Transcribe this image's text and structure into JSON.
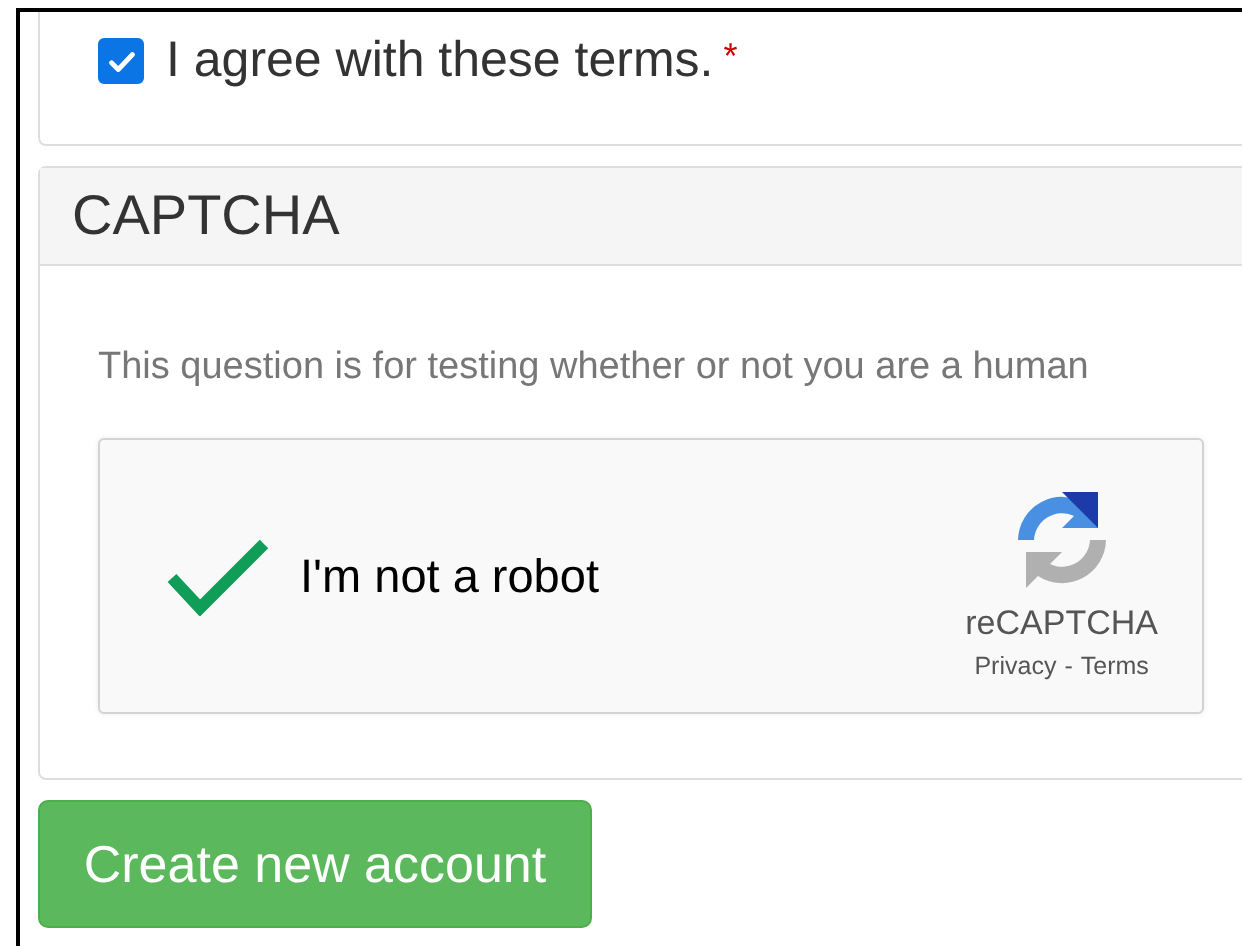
{
  "terms": {
    "label": "I agree with these terms.",
    "required_mark": "*",
    "checked": true
  },
  "captcha": {
    "title": "CAPTCHA",
    "description": "This question is for testing whether or not you are a human",
    "recaptcha": {
      "label": "I'm not a robot",
      "verified": true,
      "brand": "reCAPTCHA",
      "links": [
        "Privacy",
        "Terms"
      ],
      "separator": "-"
    }
  },
  "submit_button": "Create new account"
}
